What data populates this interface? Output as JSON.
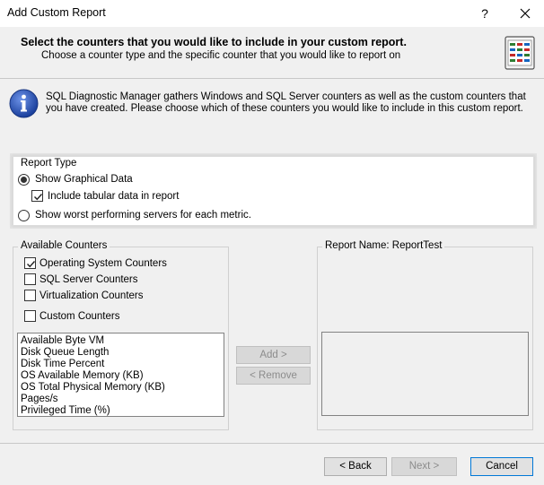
{
  "window": {
    "title": "Add Custom Report",
    "help_label": "?"
  },
  "header": {
    "title": "Select the counters that you would like to include in your custom report.",
    "subtitle": "Choose a counter type and the specific counter that you would like to report on",
    "icon": "report-grid-icon"
  },
  "info": {
    "icon": "info-icon",
    "text": "SQL Diagnostic Manager gathers Windows and SQL Server counters as well as the custom counters that you have created.  Please choose which of these counters you would like to include in this custom report."
  },
  "report_type": {
    "legend": "Report Type",
    "options": [
      {
        "label": "Show Graphical Data",
        "selected": true
      },
      {
        "label": "Show worst performing servers for each metric.",
        "selected": false
      }
    ],
    "include_tabular": {
      "label": "Include tabular data in report",
      "checked": true
    }
  },
  "available_counters": {
    "legend": "Available Counters",
    "types": [
      {
        "label": "Operating System Counters",
        "checked": true
      },
      {
        "label": "SQL Server Counters",
        "checked": false
      },
      {
        "label": "Virtualization Counters",
        "checked": false
      },
      {
        "label": "Custom Counters",
        "checked": false
      }
    ],
    "items": [
      "Available Byte VM",
      "Disk Queue Length",
      "Disk Time Percent",
      "OS Available Memory (KB)",
      "OS Total Physical Memory (KB)",
      "Pages/s",
      "Privileged Time (%)"
    ]
  },
  "actions": {
    "add_label": "Add >",
    "remove_label": "< Remove"
  },
  "report_name": {
    "label": "Report Name: ReportTest"
  },
  "footer": {
    "back_label": "< Back",
    "next_label": "Next >",
    "cancel_label": "Cancel"
  }
}
